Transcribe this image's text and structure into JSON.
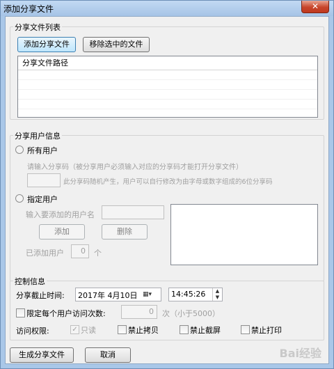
{
  "window": {
    "title": "添加分享文件",
    "close_glyph": "✕"
  },
  "share_files": {
    "group_title": "分享文件列表",
    "add_button": "添加分享文件",
    "remove_button": "移除选中的文件",
    "column_header": "分享文件路径"
  },
  "share_users": {
    "group_title": "分享用户信息",
    "all_users_label": "所有用户",
    "share_code_prompt": "请输入分享码（被分享用户必须输入对应的分享码才能打开分享文件）",
    "share_code_hint": "此分享码随机产生，用户可以自行修改为由字母或数字组成的6位分享码",
    "specific_users_label": "指定用户",
    "username_prompt": "输入要添加的用户名",
    "add_button": "添加",
    "delete_button": "删除",
    "added_users_label": "已添加用户",
    "added_users_count": "0",
    "count_unit": "个"
  },
  "control": {
    "group_title": "控制信息",
    "deadline_label": "分享截止时间:",
    "date_value": "2017年  4月10日",
    "time_value": "14:45:26",
    "limit_label": "限定每个用户访问次数:",
    "limit_value": "0",
    "limit_hint": "次（小于5000）",
    "permission_label": "访问权限:",
    "permissions": [
      {
        "label": "只读",
        "checked": true,
        "disabled": true
      },
      {
        "label": "禁止拷贝",
        "checked": false,
        "disabled": false
      },
      {
        "label": "禁止截屏",
        "checked": false,
        "disabled": false
      },
      {
        "label": "禁止打印",
        "checked": false,
        "disabled": false
      }
    ]
  },
  "footer": {
    "generate_button": "生成分享文件",
    "cancel_button": "取消"
  },
  "watermark": "Bai经验"
}
